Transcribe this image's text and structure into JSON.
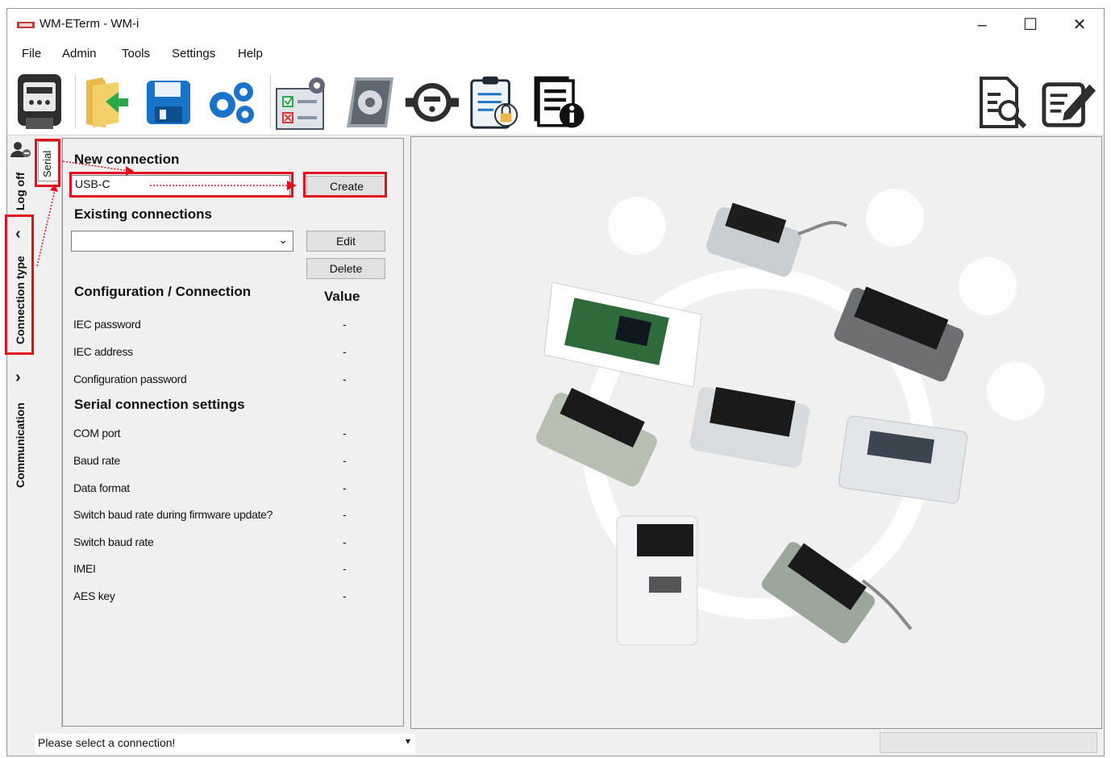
{
  "window": {
    "title": "WM-ETerm - WM-i",
    "controls": {
      "minimize": "–",
      "maximize": "☐",
      "close": "✕"
    }
  },
  "menu": [
    "File",
    "Admin",
    "Tools",
    "Settings",
    "Help"
  ],
  "toolbar": {
    "icons": [
      "meter-icon",
      "open-folder-icon",
      "save-icon",
      "settings-gears-icon",
      "checklist-config-icon",
      "firmware-gear-icon",
      "water-meter-icon",
      "clipboard-lock-icon",
      "document-info-icon"
    ],
    "right_icons": [
      "document-search-icon",
      "edit-document-icon"
    ]
  },
  "sidebar": {
    "log_off": "Log off",
    "connection_type": "Connection type",
    "communication": "Communication"
  },
  "serial_tab": "Serial",
  "new_connection": {
    "heading": "New connection",
    "input_value": "USB-C",
    "create_label": "Create"
  },
  "existing_connections": {
    "heading": "Existing connections",
    "selected": "",
    "edit_label": "Edit",
    "delete_label": "Delete"
  },
  "config": {
    "heading": "Configuration / Connection",
    "value_heading": "Value",
    "rows": [
      {
        "label": "IEC password",
        "value": "-"
      },
      {
        "label": "IEC address",
        "value": "-"
      },
      {
        "label": "Configuration password",
        "value": "-"
      }
    ]
  },
  "serial_settings": {
    "heading": "Serial connection settings",
    "rows": [
      {
        "label": "COM port",
        "value": "-"
      },
      {
        "label": "Baud rate",
        "value": "-"
      },
      {
        "label": "Data format",
        "value": "-"
      },
      {
        "label": "Switch baud rate during firmware update?",
        "value": "-"
      },
      {
        "label": "Switch baud rate",
        "value": "-"
      },
      {
        "label": "IMEI",
        "value": "-"
      },
      {
        "label": "AES key",
        "value": "-"
      }
    ]
  },
  "status": {
    "message": "Please select a connection!"
  },
  "colors": {
    "highlight": "#e0101e",
    "window_bg": "#f0f0f0",
    "accent_blue": "#1a73c8"
  }
}
